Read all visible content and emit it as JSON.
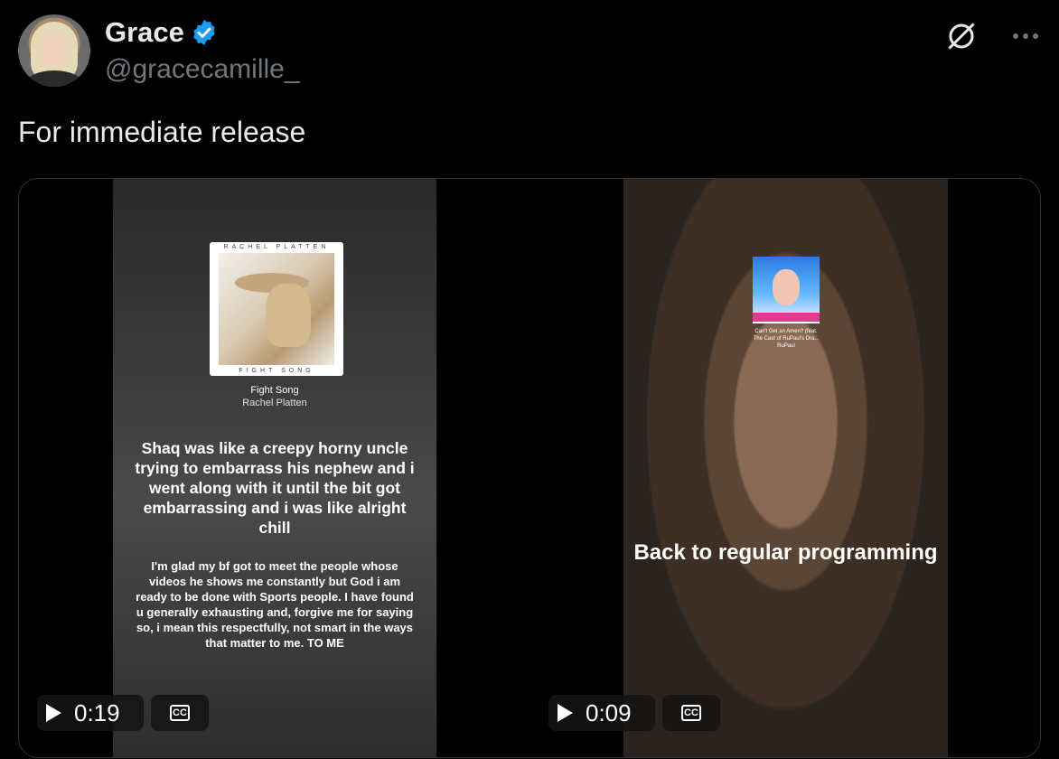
{
  "author": {
    "name": "Grace",
    "handle": "@gracecamille_",
    "verified": true
  },
  "tweet": {
    "text": "For immediate release"
  },
  "icons": {
    "verified": "verified-badge-icon",
    "grok": "grok-icon",
    "more": "more-options-icon",
    "play": "play-icon",
    "cc": "closed-captions-icon"
  },
  "videos": [
    {
      "album": {
        "top": "RACHEL PLATTEN",
        "bottom": "FIGHT SONG"
      },
      "song_title": "Fight Song",
      "song_artist": "Rachel Platten",
      "caption_main": "Shaq was like a creepy horny uncle trying to embarrass his nephew and i went along with it until the bit got embarrassing and i was like alright chill",
      "caption_sub": "I'm glad my bf got to meet the people whose videos he shows me constantly but God i am ready to be done with Sports people. I have found u generally exhausting and, forgive me for saying so, i mean this respectfully, not smart in the ways that matter to me. TO ME",
      "time": "0:19",
      "cc_label": "CC"
    },
    {
      "album_caption": "Can't Get an Amen? (feat. The Cast of RuPaul's Dra... RuPaul",
      "caption_main": "Back to regular programming",
      "time": "0:09",
      "cc_label": "CC"
    }
  ],
  "colors": {
    "verified": "#1d9bf0",
    "muted": "#71767b",
    "text": "#e7e9ea"
  }
}
